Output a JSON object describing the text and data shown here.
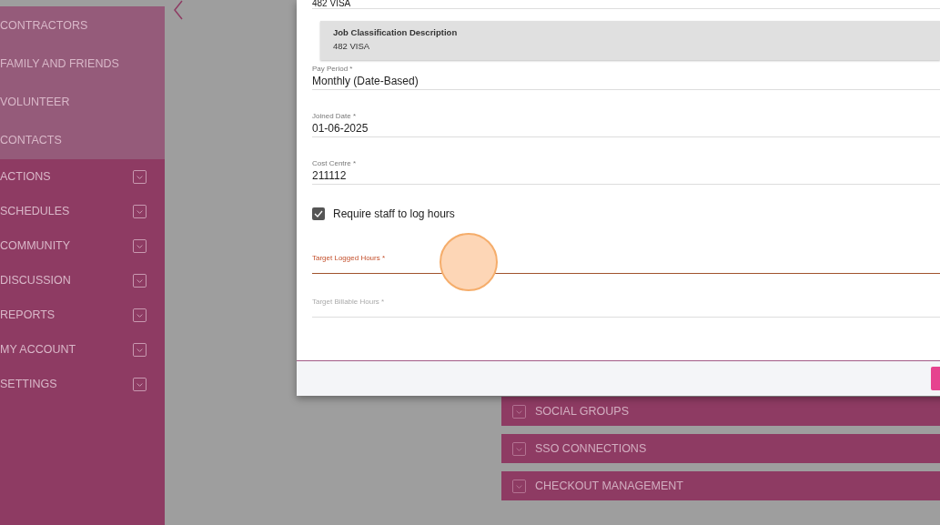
{
  "sidebar": {
    "items": [
      {
        "label": "CONTRACTORS",
        "kind": "link"
      },
      {
        "label": "FAMILY AND FRIENDS",
        "kind": "link"
      },
      {
        "label": "VOLUNTEER",
        "kind": "link"
      },
      {
        "label": "CONTACTS",
        "kind": "link"
      },
      {
        "label": "ACTIONS",
        "kind": "section"
      },
      {
        "label": "SCHEDULES",
        "kind": "section"
      },
      {
        "label": "COMMUNITY",
        "kind": "section"
      },
      {
        "label": "DISCUSSION",
        "kind": "section"
      },
      {
        "label": "REPORTS",
        "kind": "section"
      },
      {
        "label": "MY ACCOUNT",
        "kind": "section"
      },
      {
        "label": "SETTINGS",
        "kind": "section"
      }
    ]
  },
  "panels": [
    {
      "label": "SOCIAL GROUPS"
    },
    {
      "label": "SSO CONNECTIONS"
    },
    {
      "label": "CHECKOUT MANAGEMENT"
    }
  ],
  "dialog": {
    "top_value": "482 VISA",
    "classification": {
      "title": "Job Classification Description",
      "value": "482 VISA"
    },
    "fields": [
      {
        "label": "Pay Period *",
        "value": "Monthly (Date-Based)"
      },
      {
        "label": "Joined Date *",
        "value": "01-06-2025"
      },
      {
        "label": "Cost Centre *",
        "value": "211112"
      }
    ],
    "checkbox": {
      "label": "Require staff to log hours",
      "checked": true
    },
    "hours_fields": [
      {
        "label": "Target Logged Hours *",
        "focused": true
      },
      {
        "label": "Target Billable Hours *",
        "focused": false
      }
    ]
  }
}
